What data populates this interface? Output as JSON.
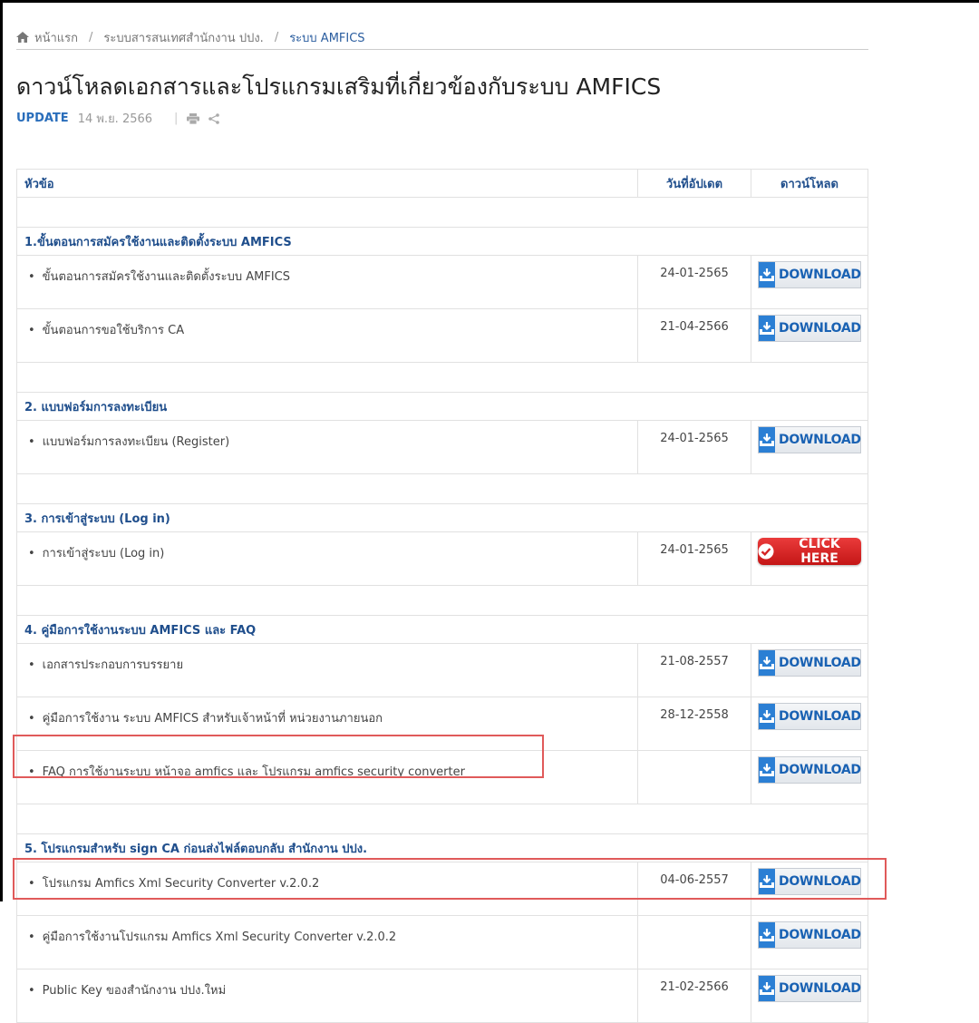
{
  "breadcrumb": {
    "home": "หน้าแรก",
    "level2": "ระบบสารสนเทศสำนักงาน ปปง.",
    "current": "ระบบ AMFICS"
  },
  "page": {
    "title": "ดาวน์โหลดเอกสารและโปรแกรมเสริมที่เกี่ยวข้องกับระบบ AMFICS",
    "update_label": "UPDATE",
    "update_date": "14 พ.ย. 2566"
  },
  "table": {
    "headers": {
      "title": "หัวข้อ",
      "date": "วันที่อัปเดต",
      "download": "ดาวน์โหลด"
    },
    "sections": [
      {
        "heading": "1.ขั้นตอนการสมัครใช้งานและติดตั้งระบบ AMFICS",
        "items": [
          {
            "title": "ขั้นตอนการสมัครใช้งานและติดตั้งระบบ AMFICS",
            "date": "24-01-2565",
            "button": "DOWNLOAD"
          },
          {
            "title": "ขั้นตอนการขอใช้บริการ CA",
            "date": "21-04-2566",
            "button": "DOWNLOAD"
          }
        ]
      },
      {
        "heading": "2. แบบฟอร์มการลงทะเบียน",
        "items": [
          {
            "title": "แบบฟอร์มการลงทะเบียน (Register)",
            "date": "24-01-2565",
            "button": "DOWNLOAD"
          }
        ]
      },
      {
        "heading": "3. การเข้าสู่ระบบ (Log in)",
        "items": [
          {
            "title": "การเข้าสู่ระบบ (Log in)",
            "date": "24-01-2565",
            "button": "CLICK HERE"
          }
        ]
      },
      {
        "heading": "4. คู่มือการใช้งานระบบ AMFICS และ FAQ",
        "items": [
          {
            "title": "เอกสารประกอบการบรรยาย",
            "date": "21-08-2557",
            "button": "DOWNLOAD"
          },
          {
            "title": "คู่มือการใช้งาน ระบบ AMFICS สำหรับเจ้าหน้าที่ หน่วยงานภายนอก",
            "date": "28-12-2558",
            "button": "DOWNLOAD"
          },
          {
            "title": "FAQ การใช้งานระบบ หน้าจอ amfics และ โปรแกรม amfics security converter",
            "date": "",
            "button": "DOWNLOAD"
          }
        ]
      },
      {
        "heading": "5. โปรแกรมสำหรับ sign CA ก่อนส่งไฟล์ตอบกลับ สำนักงาน ปปง.",
        "items": [
          {
            "title": "โปรแกรม Amfics Xml Security Converter v.2.0.2",
            "date": "04-06-2557",
            "button": "DOWNLOAD"
          },
          {
            "title": "คู่มือการใช้งานโปรแกรม Amfics Xml Security Converter v.2.0.2",
            "date": "",
            "button": "DOWNLOAD"
          },
          {
            "title": "Public Key ของสำนักงาน ปปง.ใหม่",
            "date": "21-02-2566",
            "button": "DOWNLOAD"
          }
        ]
      }
    ]
  },
  "colors": {
    "link_blue": "#1f4e8c",
    "download_icon_blue": "#2b7fd4",
    "click_red": "#d42424",
    "highlight_red": "#e05a5a"
  }
}
